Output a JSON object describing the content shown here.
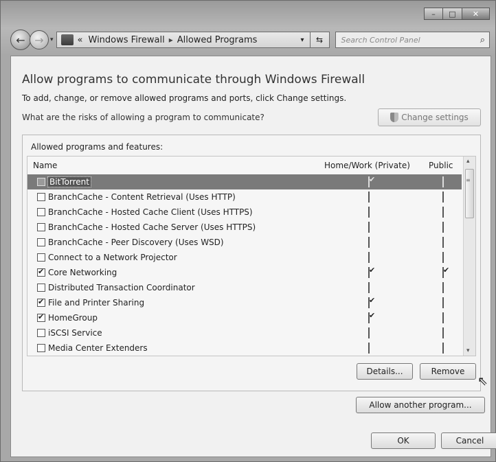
{
  "window": {
    "caption_minimize": "–",
    "caption_maximize": "□",
    "caption_close": "✕"
  },
  "navbar": {
    "back_icon": "←",
    "forward_icon": "→",
    "recent_pages": "▾",
    "breadcrumb_prefix": "«",
    "breadcrumb": [
      "Windows Firewall",
      "Allowed Programs"
    ],
    "breadcrumb_separator": "▸",
    "address_chevron": "▾",
    "refresh_icon": "⇆",
    "search_placeholder": "Search Control Panel",
    "search_icon": "⌕"
  },
  "main": {
    "title": "Allow programs to communicate through Windows Firewall",
    "subtitle": "To add, change, or remove allowed programs and ports, click Change settings.",
    "risk_link": "What are the risks of allowing a program to communicate?",
    "change_settings_label": "Change settings"
  },
  "programs": {
    "group_title": "Allowed programs and features:",
    "columns": {
      "name": "Name",
      "home": "Home/Work (Private)",
      "public": "Public"
    },
    "rows": [
      {
        "name": "BitTorrent",
        "enabled": false,
        "home": true,
        "public": false,
        "selected": true
      },
      {
        "name": "BranchCache - Content Retrieval (Uses HTTP)",
        "enabled": false,
        "home": false,
        "public": false
      },
      {
        "name": "BranchCache - Hosted Cache Client (Uses HTTPS)",
        "enabled": false,
        "home": false,
        "public": false
      },
      {
        "name": "BranchCache - Hosted Cache Server (Uses HTTPS)",
        "enabled": false,
        "home": false,
        "public": false
      },
      {
        "name": "BranchCache - Peer Discovery (Uses WSD)",
        "enabled": false,
        "home": false,
        "public": false
      },
      {
        "name": "Connect to a Network Projector",
        "enabled": false,
        "home": false,
        "public": false
      },
      {
        "name": "Core Networking",
        "enabled": true,
        "home": true,
        "public": true
      },
      {
        "name": "Distributed Transaction Coordinator",
        "enabled": false,
        "home": false,
        "public": false
      },
      {
        "name": "File and Printer Sharing",
        "enabled": true,
        "home": true,
        "public": false
      },
      {
        "name": "HomeGroup",
        "enabled": true,
        "home": true,
        "public": false
      },
      {
        "name": "iSCSI Service",
        "enabled": false,
        "home": false,
        "public": false
      },
      {
        "name": "Media Center Extenders",
        "enabled": false,
        "home": false,
        "public": false
      }
    ],
    "scroll_up": "▴",
    "scroll_down": "▾",
    "scroll_grip": "≡",
    "details_label": "Details...",
    "remove_label": "Remove",
    "cursor": "⇖"
  },
  "footer": {
    "allow_another_label": "Allow another program...",
    "ok_label": "OK",
    "cancel_label": "Cancel"
  }
}
